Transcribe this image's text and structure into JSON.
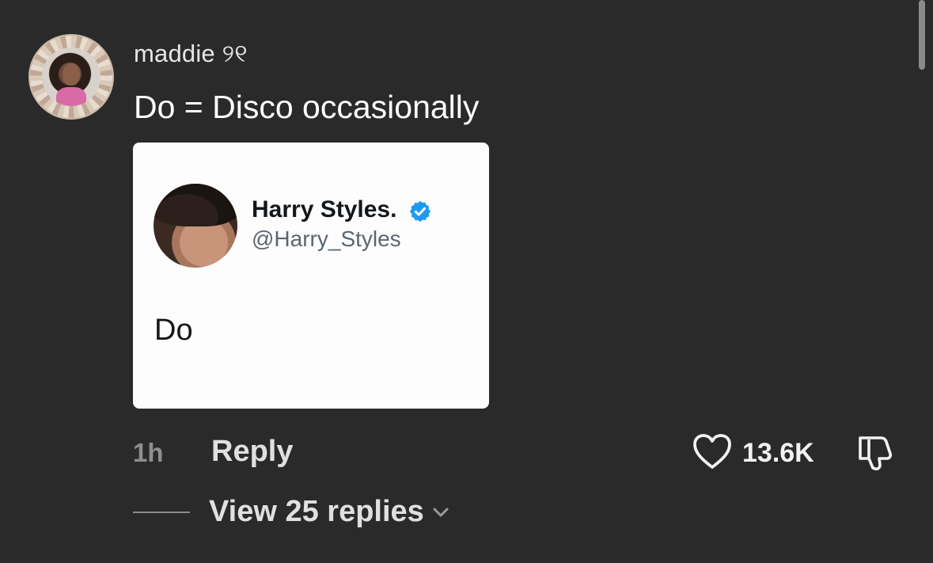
{
  "comment": {
    "username": "maddie ୨୧",
    "text": "Do = Disco occasionally",
    "time": "1h",
    "reply_label": "Reply",
    "like_count": "13.6K",
    "view_replies_label": "View 25 replies"
  },
  "tweet": {
    "name": "Harry Styles.",
    "handle": "@Harry_Styles",
    "body": "Do",
    "verified_color": "#1d9bf0"
  },
  "icons": {
    "like": "heart-icon",
    "dislike": "thumbs-down-icon",
    "expand": "chevron-down-icon"
  }
}
